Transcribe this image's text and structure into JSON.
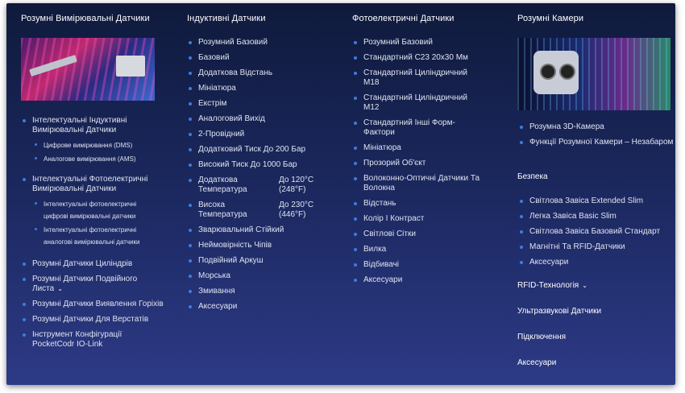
{
  "colors": {
    "background": "#1d2a63",
    "bullet": "#3d7dde",
    "text": "#dfe3f0"
  },
  "col1": {
    "heading": "Розумні Вимірювальні Датчики",
    "image_icon": "sensor-product-image",
    "group1": "Інтелектуальні Індуктивні Вимірювальні Датчики",
    "group1_sub": [
      "Цифрове вимірювання (DMS)",
      "Аналогове вимірювання (AMS)"
    ],
    "group2": "Інтелектуальні Фотоелектричні Вимірювальні Датчики",
    "group2_sub": [
      "Інтелектуальні фотоелектричні цифрові вимірювальні датчики",
      "Інтелектуальні фотоелектричні аналогові вимірювальні датчики"
    ],
    "items": [
      {
        "label": "Розумні Датчики Циліндрів",
        "chevron": ""
      },
      {
        "label": "Розумні Датчики Подвійного Листа",
        "chevron": "⌄"
      },
      {
        "label": "Розумні Датчики Виявлення Горіхів",
        "chevron": ""
      },
      {
        "label": "Розумні Датчики Для Верстатів",
        "chevron": ""
      },
      {
        "label": "Інструмент Конфігурації PocketCodr IO-Link",
        "chevron": ""
      }
    ]
  },
  "col2": {
    "heading": "Індуктивні Датчики",
    "items": [
      "Розумний Базовий",
      "Базовий",
      "Додаткова Відстань",
      "Мініатюра",
      "Екстрім",
      "Аналоговий Вихід",
      "2-Провідний",
      "Додатковий Тиск До 200 Бар",
      "Високий Тиск До 1000 Бар"
    ],
    "temp1": {
      "left": "Додаткова Температура",
      "right": "До 120°C (248°F)"
    },
    "temp2": {
      "left": "Висока Температура",
      "right": "До 230°C (446°F)"
    },
    "items2": [
      "Зварювальний Стійкий",
      "Неймовірність Чіпів",
      "Подвійний Аркуш",
      "Морська",
      "Змивання",
      "Аксесуари"
    ]
  },
  "col3": {
    "heading": "Фотоелектричні Датчики",
    "items": [
      "Розумний Базовий",
      "Стандартний C23 20x30 Мм",
      "Стандартний Циліндричний M18",
      "Стандартний Циліндричний M12",
      "Стандартний Інші Форм-Фактори",
      "Мініатюра",
      "Прозорий Об'єкт",
      "Волоконно-Оптичні Датчики Та Волокна",
      "Відстань",
      "Колір І Контраст",
      "Світлові Сітки",
      "Вилка",
      "Відбивачі",
      "Аксесуари"
    ]
  },
  "col4": {
    "heading": "Розумні Камери",
    "image_icon": "3d-camera-image",
    "camera_items": [
      "Розумна 3D-Камера",
      "Функції Розумної Камери – Незабаром"
    ],
    "safety_heading": "Безпека",
    "safety_items": [
      "Світлова Завіса Extended Slim",
      "Легка Завіса Basic Slim",
      "Світлова Завіса Базовий Стандарт",
      "Магнітні Та RFID-Датчики",
      "Аксесуари"
    ],
    "rfid": "RFID-Технологія",
    "rfid_chevron": "⌄",
    "ultrasonic": "Ультразвукові Датчики",
    "connection": "Підключення",
    "accessories": "Аксесуари"
  }
}
